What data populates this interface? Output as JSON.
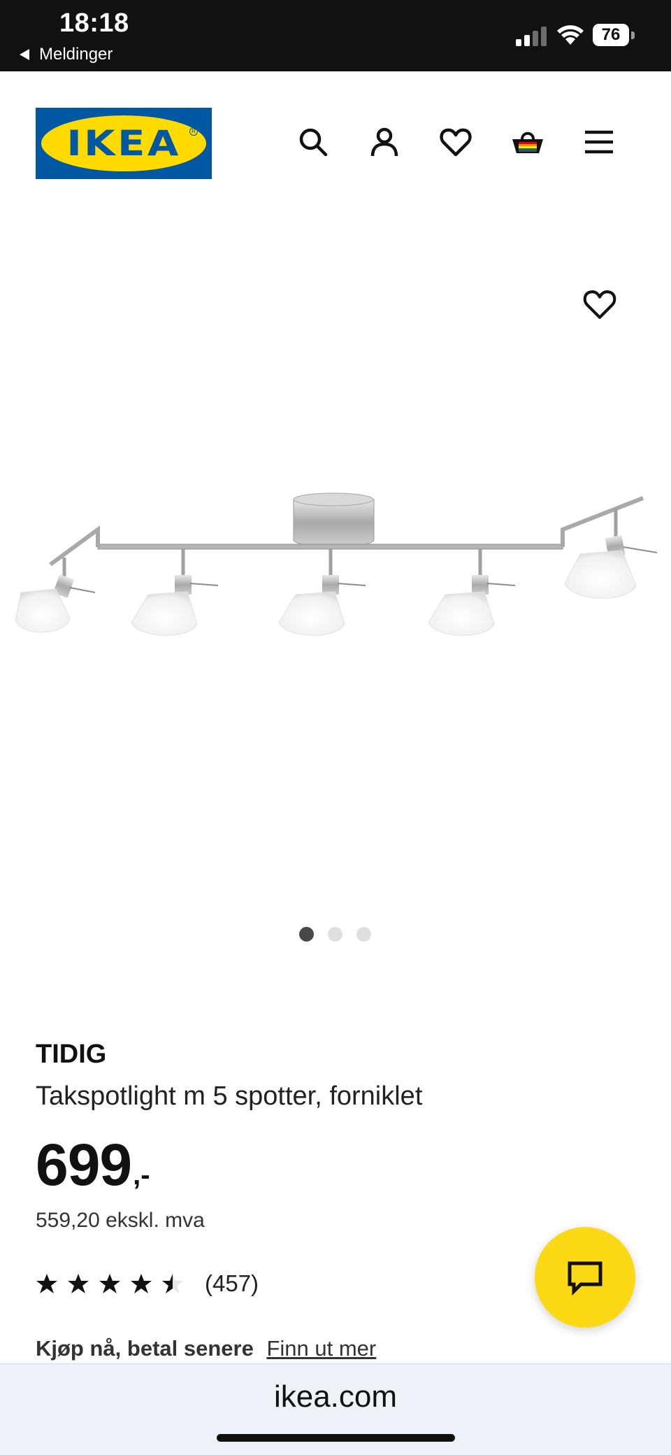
{
  "status_bar": {
    "time": "18:18",
    "back_label": "Meldinger",
    "battery": "76"
  },
  "header": {
    "logo_text": "IKEA",
    "icons": [
      "search-icon",
      "user-icon",
      "heart-icon",
      "basket-icon",
      "menu-icon"
    ]
  },
  "gallery": {
    "image": "ceiling-spotlight-5-spots",
    "page_count": 3,
    "active_index": 0
  },
  "product": {
    "name": "TIDIG",
    "description": "Takspotlight m 5 spotter, forniklet",
    "price": "699",
    "price_suffix": ",-",
    "price_excl_vat": "559,20 ekskl. mva",
    "rating": 4.5,
    "review_count": "(457)",
    "bnpl_label": "Kjøp nå, betal senere",
    "bnpl_link": "Finn ut mer"
  },
  "browser": {
    "url": "ikea.com"
  },
  "colors": {
    "ikea_blue": "#0058a3",
    "ikea_yellow": "#ffdb00",
    "chat_yellow": "#fbd914"
  }
}
